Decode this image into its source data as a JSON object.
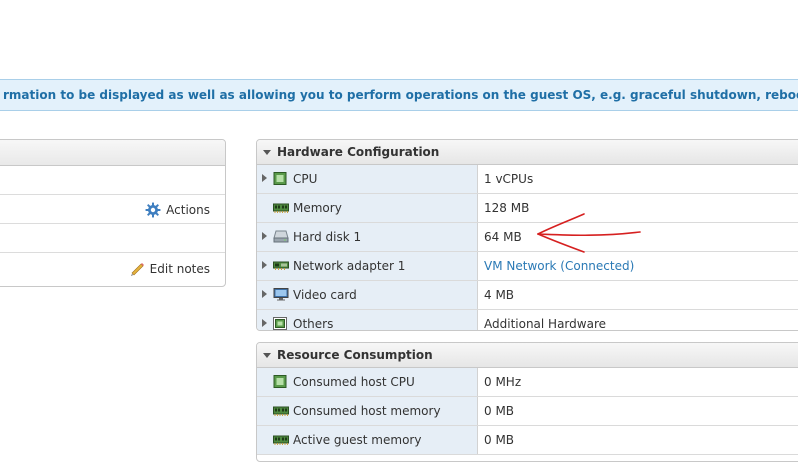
{
  "banner": {
    "text": "rmation to be displayed as well as allowing you to perform operations on the guest OS, e.g. graceful shutdown, reboot, etc. You should install V"
  },
  "left_panel": {
    "actions_label": "Actions",
    "edit_notes_label": "Edit notes"
  },
  "hardware": {
    "title": "Hardware Configuration",
    "rows": [
      {
        "label": "CPU",
        "value": "1 vCPUs",
        "icon": "cpu-icon"
      },
      {
        "label": "Memory",
        "value": "128 MB",
        "icon": "memory-icon"
      },
      {
        "label": "Hard disk 1",
        "value": "64 MB",
        "icon": "hard-disk-icon"
      },
      {
        "label": "Network adapter 1",
        "value": "VM Network (Connected)",
        "icon": "network-adapter-icon"
      },
      {
        "label": "Video card",
        "value": "4 MB",
        "icon": "monitor-icon"
      },
      {
        "label": "Others",
        "value": "Additional Hardware",
        "icon": "others-icon"
      }
    ]
  },
  "resources": {
    "title": "Resource Consumption",
    "rows": [
      {
        "label": "Consumed host CPU",
        "value": "0 MHz",
        "icon": "cpu-icon"
      },
      {
        "label": "Consumed host memory",
        "value": "0 MB",
        "icon": "memory-icon"
      },
      {
        "label": "Active guest memory",
        "value": "0 MB",
        "icon": "memory-icon"
      }
    ]
  },
  "colors": {
    "banner_bg": "#e3f1fb",
    "banner_text": "#1f6fa6",
    "link": "#2a79b5",
    "annotation": "#d62020"
  }
}
